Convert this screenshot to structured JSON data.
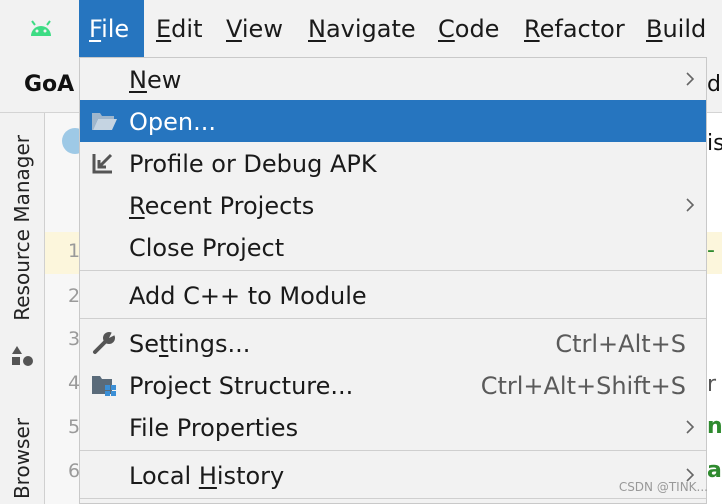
{
  "menubar": {
    "items": [
      "File",
      "Edit",
      "View",
      "Navigate",
      "Code",
      "Refactor",
      "Build"
    ],
    "mnemonics": [
      "F",
      "E",
      "V",
      "N",
      "C",
      "R",
      "B"
    ],
    "rest": [
      "ile",
      "dit",
      "iew",
      "avigate",
      "ode",
      "efactor",
      "uild"
    ]
  },
  "project": {
    "name": "GoA"
  },
  "sidebar": {
    "resource_manager": "Resource Manager",
    "browser": "Browser"
  },
  "gutter": {
    "line_numbers": [
      "1",
      "2",
      "3",
      "4",
      "5",
      "6"
    ]
  },
  "file_menu": {
    "new": {
      "m": "N",
      "r": "ew"
    },
    "open": {
      "label": "Open..."
    },
    "profile": {
      "label": "Profile or Debug APK"
    },
    "recent": {
      "m": "R",
      "r": "ecent Projects"
    },
    "close": {
      "label": "Close Project"
    },
    "add_cpp": {
      "label": "Add C++ to Module"
    },
    "settings": {
      "a": "Se",
      "m": "t",
      "r": "tings...",
      "shortcut": "Ctrl+Alt+S"
    },
    "structure": {
      "label": "Project Structure...",
      "shortcut": "Ctrl+Alt+Shift+S"
    },
    "properties": {
      "label": "File Properties"
    },
    "history": {
      "a": "Local ",
      "m": "H",
      "r": "istory"
    }
  },
  "right_fragments": [
    "do",
    "is",
    "-",
    "r",
    "n",
    "a"
  ],
  "watermark": "CSDN @TINK...",
  "colors": {
    "accent": "#2675bf",
    "android_green": "#3ddc84",
    "code_green": "#2e8a2e"
  }
}
